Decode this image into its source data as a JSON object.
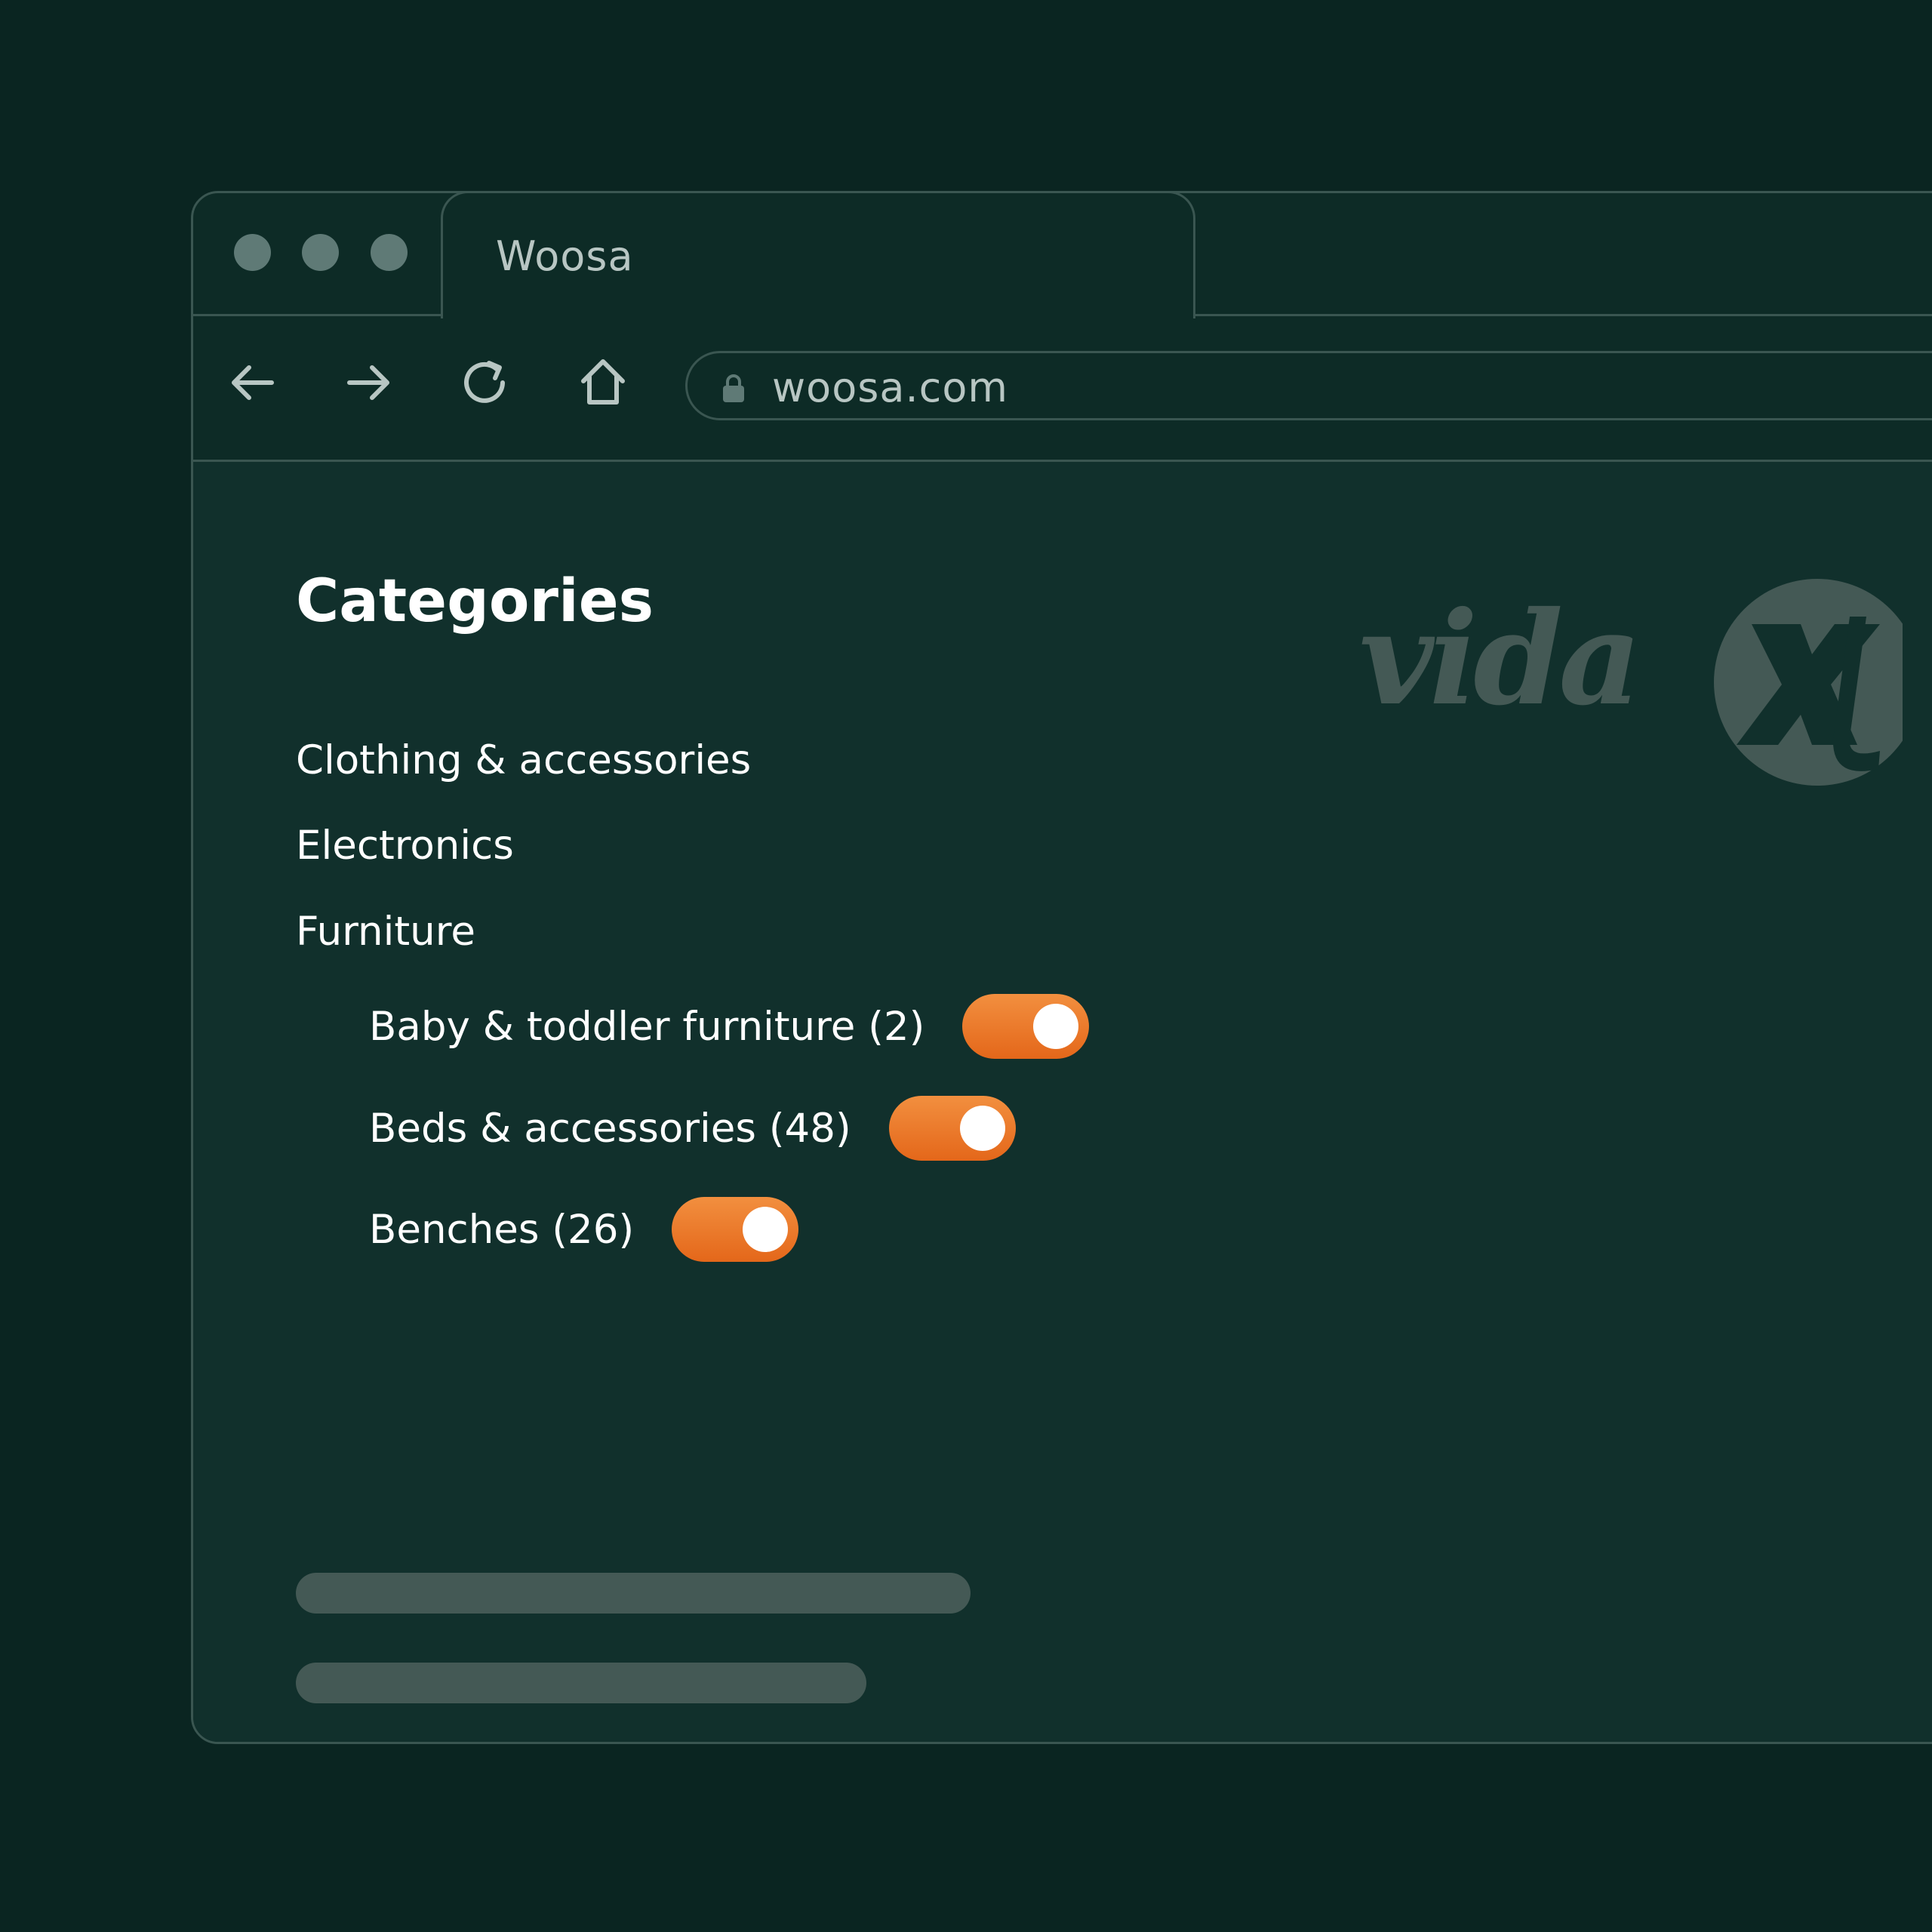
{
  "browser": {
    "tab": {
      "title": "Woosa"
    },
    "address_bar": {
      "url": "woosa.com"
    },
    "nav_icons": [
      "back-arrow-icon",
      "forward-arrow-icon",
      "reload-icon",
      "home-icon"
    ]
  },
  "page": {
    "heading": "Categories",
    "categories": [
      "Clothing & accessories",
      "Electronics",
      "Furniture"
    ],
    "subcategories": [
      {
        "label": "Baby & toddler furniture (2)",
        "enabled": true
      },
      {
        "label": "Beds & accessories (48)",
        "enabled": true
      },
      {
        "label": "Benches (26)",
        "enabled": true
      }
    ],
    "logo_text": "vidaXL"
  },
  "colors": {
    "background": "#0a2521",
    "content_background": "#11302c",
    "toggle_accent": "#ee7d2b",
    "placeholder": "#445955",
    "logo": "#445955"
  }
}
